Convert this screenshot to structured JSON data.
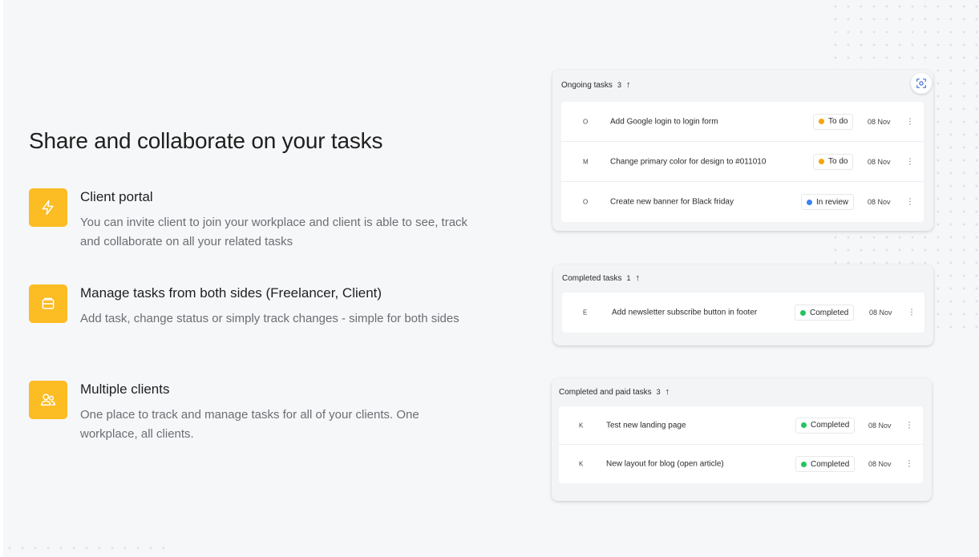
{
  "headline": "Share and collaborate on your tasks",
  "features": [
    {
      "icon": "lightning-icon",
      "title": "Client portal",
      "description": "You can invite client to join your workplace and client is able to see, track and collaborate on all your related tasks"
    },
    {
      "icon": "tray-icon",
      "title": "Manage tasks from both sides (Freelancer, Client)",
      "description": "Add task, change status or simply track changes - simple for both sides"
    },
    {
      "icon": "users-icon",
      "title": "Multiple clients",
      "description": "One place to track and manage tasks for all of your clients. One workplace, all clients."
    }
  ],
  "colors": {
    "accent": "#fbbc24",
    "todo": "#f5a50b",
    "in_review": "#3b82f6",
    "completed": "#22c55e"
  },
  "panels": {
    "ongoing": {
      "title": "Ongoing tasks",
      "count": "3",
      "rows": [
        {
          "initial": "O",
          "name": "Add Google login to login form",
          "status": "To do",
          "date": "08 Nov"
        },
        {
          "initial": "M",
          "name": "Change primary color for design to #011010",
          "status": "To do",
          "date": "08 Nov"
        },
        {
          "initial": "O",
          "name": "Create new banner for Black friday",
          "status": "In review",
          "date": "08 Nov"
        }
      ]
    },
    "completed": {
      "title": "Completed tasks",
      "count": "1",
      "rows": [
        {
          "initial": "E",
          "name": "Add newsletter subscribe button in footer",
          "status": "Completed",
          "date": "08 Nov"
        }
      ]
    },
    "paid": {
      "title": "Completed and paid tasks",
      "count": "3",
      "rows": [
        {
          "initial": "K",
          "name": "Test new landing page",
          "status": "Completed",
          "date": "08 Nov"
        },
        {
          "initial": "K",
          "name": "New layout for blog (open article)",
          "status": "Completed",
          "date": "08 Nov"
        }
      ]
    }
  }
}
